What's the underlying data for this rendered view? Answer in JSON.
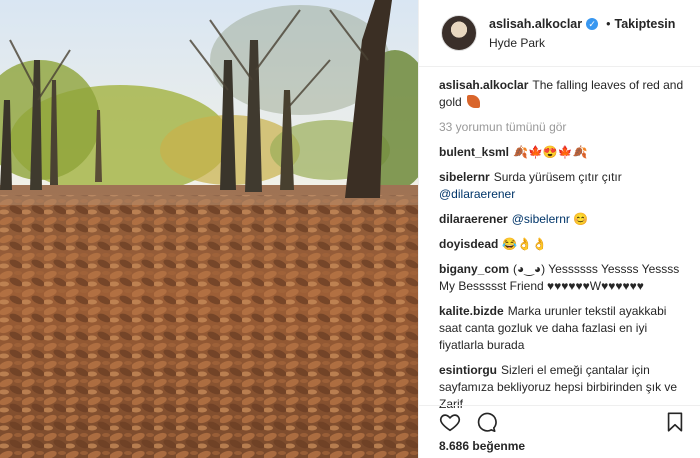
{
  "header": {
    "username": "aslisah.alkoclar",
    "verified_glyph": "✓",
    "separator": "•",
    "follow_label": "Takiptesin",
    "location": "Hyde Park"
  },
  "caption": {
    "username": "aslisah.alkoclar",
    "text": "The falling leaves of red and gold"
  },
  "view_all": "33 yorumun tümünü gör",
  "comments": [
    {
      "user": "bulent_ksml",
      "text": "🍂🍁😍🍁🍂"
    },
    {
      "user": "sibelernr",
      "text": "Surda yürüsem çıtır çıtır",
      "mention": "@dilaraerener"
    },
    {
      "user": "dilaraerener",
      "mention": "@sibelernr",
      "text": "😊"
    },
    {
      "user": "doyisdead",
      "text": "😂👌👌"
    },
    {
      "user": "bigany_com",
      "text": "(◕‿◕) Yessssss Yessss Yessss My Bessssst Friend ♥♥♥♥♥♥W♥♥♥♥♥♥"
    },
    {
      "user": "kalite.bizde",
      "text": "Marka urunler tekstil ayakkabi saat canta gozluk ve daha fazlasi en iyi fiyatlarla burada"
    },
    {
      "user": "esintiorgu",
      "text": "Sizleri el emeği çantalar için sayfamıza bekliyoruz hepsi birbirinden şık ve Zarif"
    }
  ],
  "likes": "8.686 beğenme",
  "icons": {
    "like": "heart-icon",
    "comment": "comment-icon",
    "save": "bookmark-icon",
    "verified": "verified-badge-icon",
    "caption_emoji": "fallen-leaf-emoji"
  },
  "colors": {
    "verified": "#3897f0",
    "mention": "#003569",
    "muted": "#999999",
    "text": "#262626"
  }
}
